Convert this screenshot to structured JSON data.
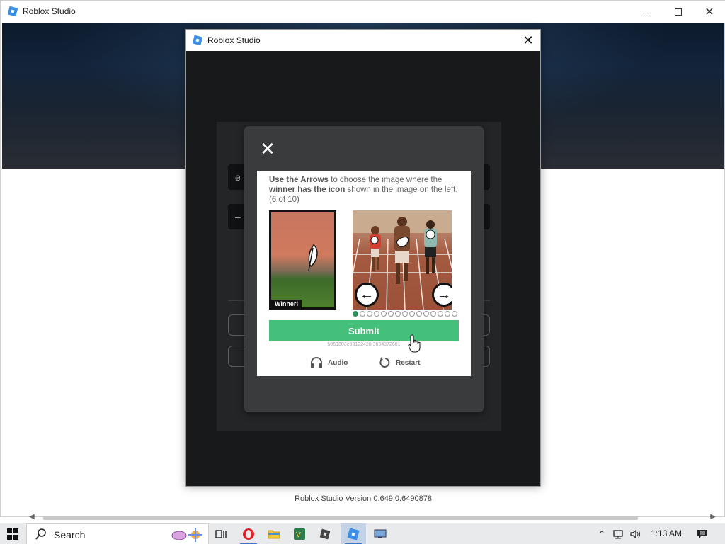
{
  "window": {
    "title": "Roblox Studio",
    "minimize_icon": "minimize-icon",
    "maximize_icon": "maximize-icon",
    "close_icon": "close-icon"
  },
  "dialog": {
    "title": "Roblox Studio",
    "close_icon": "close-icon"
  },
  "login": {
    "field1_value": "e",
    "field2_value": "–"
  },
  "captcha": {
    "instruction_bold_1": "Use the Arrows",
    "instruction_text_1": " to choose the image where the ",
    "instruction_bold_2": "winner has the icon",
    "instruction_text_2": " shown in the image on the left. (6 of 10)",
    "reference_label": "Winner!",
    "current_image_index": 1,
    "total_images": 15,
    "submit_label": "Submit",
    "session_id": "5051803e03122428.3694372601",
    "audio_label": "Audio",
    "restart_label": "Restart",
    "accent_color": "#45c07a"
  },
  "footer": {
    "version": "Roblox Studio Version 0.649.0.6490878"
  },
  "taskbar": {
    "search_placeholder": "Search",
    "clock": "1:13 AM",
    "apps": [
      "task-view-icon",
      "opera-icon",
      "file-explorer-icon",
      "visual-studio-icon",
      "roblox-player-icon",
      "roblox-studio-icon",
      "remote-desktop-icon"
    ]
  }
}
